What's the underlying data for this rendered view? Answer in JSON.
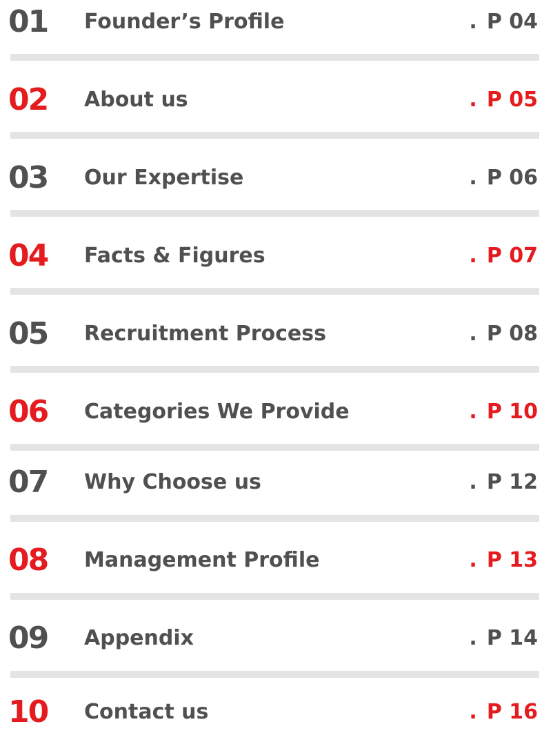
{
  "toc": {
    "entries": [
      {
        "number": "01",
        "title": "Founder’s Profile",
        "dot": ".",
        "page": "P 04",
        "accent": "dark"
      },
      {
        "number": "02",
        "title": "About us",
        "dot": ".",
        "page": "P 05",
        "accent": "red"
      },
      {
        "number": "03",
        "title": "Our Expertise",
        "dot": ".",
        "page": "P 06",
        "accent": "dark"
      },
      {
        "number": "04",
        "title": "Facts & Figures",
        "dot": ".",
        "page": "P 07",
        "accent": "red"
      },
      {
        "number": "05",
        "title": "Recruitment Process",
        "dot": ".",
        "page": "P 08",
        "accent": "dark"
      },
      {
        "number": "06",
        "title": "Categories We Provide",
        "dot": ".",
        "page": "P 10",
        "accent": "red"
      },
      {
        "number": "07",
        "title": "Why Choose us",
        "dot": ".",
        "page": "P 12",
        "accent": "dark"
      },
      {
        "number": "08",
        "title": "Management Profile",
        "dot": ".",
        "page": "P 13",
        "accent": "red"
      },
      {
        "number": "09",
        "title": "Appendix",
        "dot": ".",
        "page": "P 14",
        "accent": "dark"
      },
      {
        "number": "10",
        "title": "Contact us",
        "dot": ".",
        "page": "P 16",
        "accent": "red"
      }
    ]
  },
  "colors": {
    "dark_text": "#505050",
    "accent_red": "#e41b1f",
    "divider": "#e4e4e4"
  }
}
